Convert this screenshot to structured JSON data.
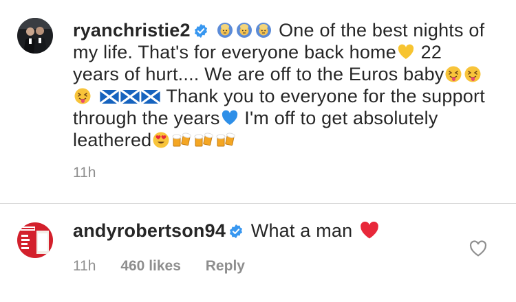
{
  "comments": [
    {
      "username": "ryanchristie2",
      "text_parts": [
        "One of the best nights of my life. That's for everyone back home",
        "22 years of hurt.... We are off to the Euros baby",
        "Thank you to everyone for the support through the years",
        "I'm off to get absolutely leathered"
      ],
      "time": "11h"
    },
    {
      "username": "andyrobertson94",
      "text": "What a man",
      "time": "11h",
      "likes": "460 likes",
      "reply_label": "Reply"
    }
  ],
  "colors": {
    "text": "#262626",
    "meta": "#8e8e8e",
    "verified": "#3897f0",
    "divider": "#dbdbdb"
  },
  "icons": [
    "verified-badge-icon",
    "heart-outline-icon",
    "red-heart-emoji",
    "yellow-heart-emoji",
    "blue-heart-emoji",
    "scotland-flag-emoji",
    "tongue-emoji",
    "heart-eyes-emoji",
    "beer-emoji",
    "hands-up-emoji"
  ]
}
